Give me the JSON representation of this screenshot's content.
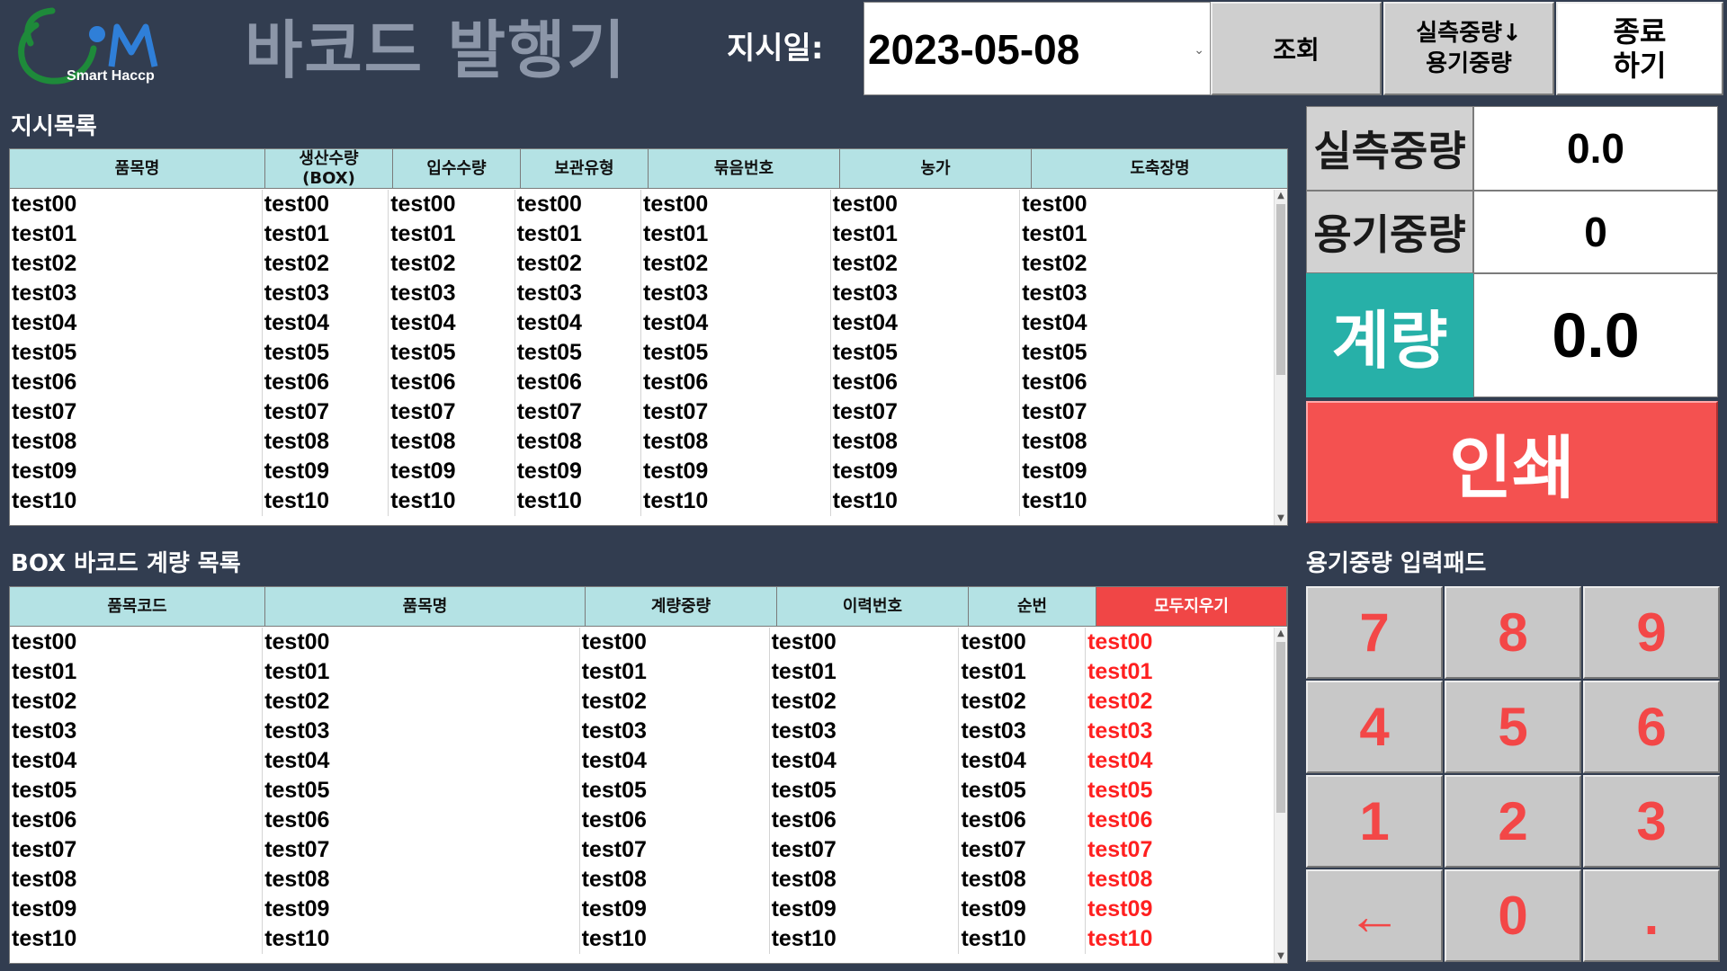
{
  "header": {
    "logo_text": "Smart Haccp",
    "title": "바코드 발행기",
    "date_label": "지시일:",
    "date_value": "2023-05-08",
    "btn_search": "조회",
    "btn_swap_line1": "실측중량↓",
    "btn_swap_line2": "용기중량",
    "btn_exit_line1": "종료",
    "btn_exit_line2": "하기"
  },
  "orders": {
    "section_title": "지시목록",
    "columns": [
      "품목명",
      "생산수량\n(BOX)",
      "입수수량",
      "보관유형",
      "묶음번호",
      "농가",
      "도축장명"
    ],
    "rows": [
      [
        "test00",
        "test00",
        "test00",
        "test00",
        "test00",
        "test00",
        "test00"
      ],
      [
        "test01",
        "test01",
        "test01",
        "test01",
        "test01",
        "test01",
        "test01"
      ],
      [
        "test02",
        "test02",
        "test02",
        "test02",
        "test02",
        "test02",
        "test02"
      ],
      [
        "test03",
        "test03",
        "test03",
        "test03",
        "test03",
        "test03",
        "test03"
      ],
      [
        "test04",
        "test04",
        "test04",
        "test04",
        "test04",
        "test04",
        "test04"
      ],
      [
        "test05",
        "test05",
        "test05",
        "test05",
        "test05",
        "test05",
        "test05"
      ],
      [
        "test06",
        "test06",
        "test06",
        "test06",
        "test06",
        "test06",
        "test06"
      ],
      [
        "test07",
        "test07",
        "test07",
        "test07",
        "test07",
        "test07",
        "test07"
      ],
      [
        "test08",
        "test08",
        "test08",
        "test08",
        "test08",
        "test08",
        "test08"
      ],
      [
        "test09",
        "test09",
        "test09",
        "test09",
        "test09",
        "test09",
        "test09"
      ],
      [
        "test10",
        "test10",
        "test10",
        "test10",
        "test10",
        "test10",
        "test10"
      ]
    ]
  },
  "box_list": {
    "section_title": "BOX 바코드 계량 목록",
    "columns": [
      "품목코드",
      "품목명",
      "계량중량",
      "이력번호",
      "순번",
      "모두지우기"
    ],
    "rows": [
      [
        "test00",
        "test00",
        "test00",
        "test00",
        "test00",
        "test00"
      ],
      [
        "test01",
        "test01",
        "test01",
        "test01",
        "test01",
        "test01"
      ],
      [
        "test02",
        "test02",
        "test02",
        "test02",
        "test02",
        "test02"
      ],
      [
        "test03",
        "test03",
        "test03",
        "test03",
        "test03",
        "test03"
      ],
      [
        "test04",
        "test04",
        "test04",
        "test04",
        "test04",
        "test04"
      ],
      [
        "test05",
        "test05",
        "test05",
        "test05",
        "test05",
        "test05"
      ],
      [
        "test06",
        "test06",
        "test06",
        "test06",
        "test06",
        "test06"
      ],
      [
        "test07",
        "test07",
        "test07",
        "test07",
        "test07",
        "test07"
      ],
      [
        "test08",
        "test08",
        "test08",
        "test08",
        "test08",
        "test08"
      ],
      [
        "test09",
        "test09",
        "test09",
        "test09",
        "test09",
        "test09"
      ],
      [
        "test10",
        "test10",
        "test10",
        "test10",
        "test10",
        "test10"
      ]
    ]
  },
  "weights": {
    "actual_label": "실측중량",
    "actual_value": "0.0",
    "container_label": "용기중량",
    "container_value": "0",
    "weigh_label": "계량",
    "weigh_value": "0.0",
    "print_label": "인쇄"
  },
  "keypad": {
    "title": "용기중량 입력패드",
    "keys": [
      "7",
      "8",
      "9",
      "4",
      "5",
      "6",
      "1",
      "2",
      "3",
      "←",
      "0",
      "."
    ]
  },
  "colors": {
    "background": "#323d50",
    "header_cell": "#b4e2e4",
    "clear_all": "#f04646",
    "weigh_accent": "#27b0a8",
    "print_button": "#f45150",
    "keypad_text": "#f34747"
  }
}
